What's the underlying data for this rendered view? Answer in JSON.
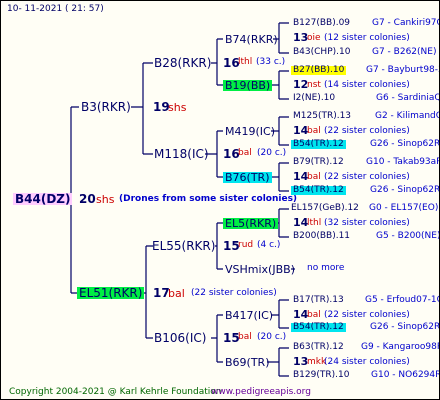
{
  "header": {
    "date": "10-  11-2021  (  21:  57)"
  },
  "footer": {
    "copyright": "Copyright 2004-2021 @ Karl Kehrle Foundation",
    "site": "www.pedigreeapis.org"
  },
  "colors": {
    "dark": "#000066",
    "red": "#cc0000",
    "blue": "#0000cc",
    "green": "#006600",
    "purple": "#660099",
    "yellow": "#ffff00",
    "greenbox": "#00ee44",
    "cyanbox": "#00e5ee",
    "pinkbox": "#ffccff"
  },
  "root": {
    "name": "B44(DZ)",
    "gen": "20",
    "breed": "shs",
    "note": "(Drones from some sister colonies)"
  },
  "gen1": [
    {
      "name": "B3(RKR)",
      "gen": "19",
      "breed": "shs"
    },
    {
      "name": "EL51(RKR)",
      "gen": "17",
      "breed": "bal",
      "note": "(22 sister colonies)"
    }
  ],
  "gen2": [
    {
      "name": "B28(RKR)",
      "gen": "16",
      "breed": "lthl",
      "note": "(33 c.)"
    },
    {
      "name": "M118(IC)",
      "gen": "16",
      "breed": "bal",
      "note": "(20 c.)"
    },
    {
      "name": "EL55(RKR)",
      "gen": "15",
      "breed": "rud",
      "note": "(4 c.)"
    },
    {
      "name": "B106(IC)",
      "gen": "15",
      "breed": "bal",
      "note": "(20 c.)"
    }
  ],
  "gen3": [
    {
      "name": "B74(RKR)"
    },
    {
      "name": "B19(BB)"
    },
    {
      "name": "M419(IC)"
    },
    {
      "name": "B76(TR)"
    },
    {
      "name": "EL5(RKR)"
    },
    {
      "name": "VSHmix(JBB)"
    },
    {
      "name": "B417(IC)"
    },
    {
      "name": "B69(TR)"
    }
  ],
  "gen4": [
    {
      "name": "B127(BB).09",
      "ref": "G7 - Cankiri97Q"
    },
    {
      "gen": "13",
      "breed": "oie",
      "note": "(12 sister colonies)"
    },
    {
      "name": "B43(CHP).10",
      "ref": "G7 - B262(NE)"
    },
    {
      "name": "B27(BB).10",
      "ref": "G7 - Bayburt98-3"
    },
    {
      "gen": "12",
      "breed": "nst",
      "note": "(14 sister colonies)"
    },
    {
      "name": "I2(NE).10",
      "ref": "G6 - SardiniaQ"
    },
    {
      "name": "M125(TR).13",
      "ref": "G2 - KilimandQ"
    },
    {
      "gen": "14",
      "breed": "bal",
      "note": "(22 sister colonies)"
    },
    {
      "name": "B54(TR).12",
      "ref": "G26 - Sinop62R"
    },
    {
      "name": "B79(TR).12",
      "ref": "G10 - Takab93aR"
    },
    {
      "gen": "14",
      "breed": "bal",
      "note": "(22 sister colonies)"
    },
    {
      "name": "B54(TR).12",
      "ref": "G26 - Sinop62R"
    },
    {
      "name": "EL157(GeB).12",
      "ref": "G0 - EL157(EO)"
    },
    {
      "gen": "14",
      "breed": "lthl",
      "note": "(32 sister colonies)"
    },
    {
      "name": "B200(BB).11",
      "ref": "G5 - B200(NE)"
    },
    {
      "note": "no more"
    },
    {
      "name": "B17(TR).13",
      "ref": "G5 - Erfoud07-1Q"
    },
    {
      "gen": "14",
      "breed": "bal",
      "note": "(22 sister colonies)"
    },
    {
      "name": "B54(TR).12",
      "ref": "G26 - Sinop62R"
    },
    {
      "name": "B63(TR).12",
      "ref": "G9 - Kangaroo98R"
    },
    {
      "gen": "13",
      "breed": "mkk",
      "note": "(24 sister colonies)"
    },
    {
      "name": "B129(TR).10",
      "ref": "G10 - NO6294R"
    }
  ]
}
